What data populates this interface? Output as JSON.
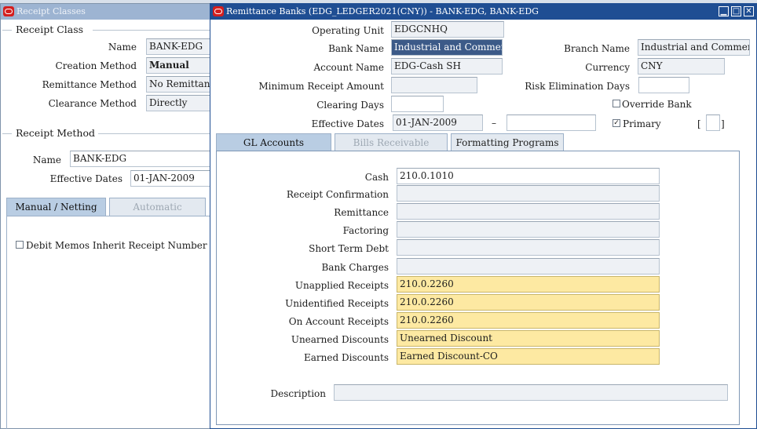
{
  "receipt_classes": {
    "title": "Receipt Classes",
    "receipt_class_group": "Receipt Class",
    "name_label": "Name",
    "name_value": "BANK-EDG",
    "creation_method_label": "Creation Method",
    "creation_method_value": "Manual",
    "remittance_method_label": "Remittance Method",
    "remittance_method_value": "No Remittance",
    "clearance_method_label": "Clearance Method",
    "clearance_method_value": "Directly",
    "receipt_method_group": "Receipt Method",
    "method_name_label": "Name",
    "method_name_value": "BANK-EDG",
    "effective_dates_label": "Effective Dates",
    "effective_dates_value": "01-JAN-2009",
    "tabs": [
      "Manual / Netting",
      "Automatic"
    ],
    "debit_memos_label": "Debit Memos Inherit Receipt Number"
  },
  "remittance_banks": {
    "title": "Remittance Banks (EDG_LEDGER2021(CNY)) - BANK-EDG, BANK-EDG",
    "operating_unit_label": "Operating Unit",
    "operating_unit_value": "EDGCNHQ",
    "bank_name_label": "Bank Name",
    "bank_name_value": "Industrial and Commercial Bank",
    "branch_name_label": "Branch Name",
    "branch_name_value": "Industrial and Commercial Bank",
    "account_name_label": "Account Name",
    "account_name_value": "EDG-Cash SH",
    "currency_label": "Currency",
    "currency_value": "CNY",
    "min_receipt_label": "Minimum Receipt Amount",
    "min_receipt_value": "",
    "risk_days_label": "Risk Elimination Days",
    "risk_days_value": "",
    "clearing_days_label": "Clearing Days",
    "clearing_days_value": "",
    "override_bank_label": "Override Bank",
    "override_bank_checked": false,
    "effective_dates_label": "Effective Dates",
    "effective_from": "01-JAN-2009",
    "effective_separator": "–",
    "effective_to": "",
    "primary_label": "Primary",
    "primary_checked": true,
    "check_mark": "✓",
    "flex_open": "[",
    "flex_close": "]",
    "tabs": [
      "GL Accounts",
      "Bills Receivable",
      "Formatting Programs"
    ],
    "gl": {
      "cash_label": "Cash",
      "cash_value": "210.0.1010",
      "receipt_confirmation_label": "Receipt Confirmation",
      "receipt_confirmation_value": "",
      "remittance_label": "Remittance",
      "remittance_value": "",
      "factoring_label": "Factoring",
      "factoring_value": "",
      "short_term_debt_label": "Short Term Debt",
      "short_term_debt_value": "",
      "bank_charges_label": "Bank Charges",
      "bank_charges_value": "",
      "unapplied_label": "Unapplied Receipts",
      "unapplied_value": "210.0.2260",
      "unidentified_label": "Unidentified Receipts",
      "unidentified_value": "210.0.2260",
      "on_account_label": "On Account Receipts",
      "on_account_value": "210.0.2260",
      "unearned_label": "Unearned Discounts",
      "unearned_value": "Unearned Discount",
      "earned_label": "Earned Discounts",
      "earned_value": "Earned Discount-CO",
      "description_label": "Description",
      "description_value": ""
    },
    "window_buttons": [
      "▁",
      "□",
      "✕"
    ]
  },
  "colors": {
    "titlebar_active": "#1f4e93",
    "titlebar_inactive": "#9db4d2",
    "required_field": "#fde9a2",
    "selected_text": "#3c5a88",
    "oracle_red": "#d41e1e"
  }
}
